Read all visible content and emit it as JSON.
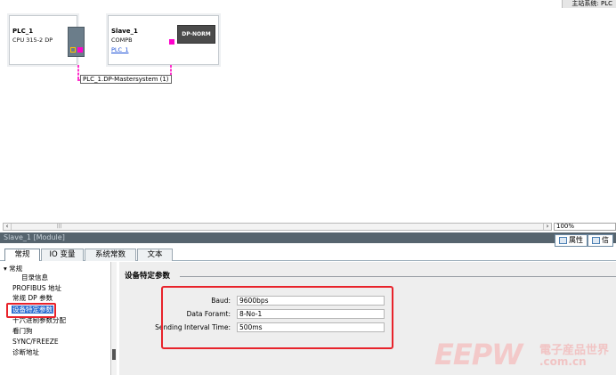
{
  "header": {
    "top_button_label": "主站系统: PLC"
  },
  "network": {
    "plc": {
      "name": "PLC_1",
      "type": "CPU 315-2 DP"
    },
    "slave": {
      "name": "Slave_1",
      "type": "COMPB",
      "link": "PLC_1",
      "module_label": "DP-NORM"
    },
    "bus_label": "PLC_1.DP-Mastersystem (1)"
  },
  "canvas": {
    "zoom": "100%"
  },
  "inspector": {
    "title": "Slave_1 [Module]",
    "tabs": [
      "属性",
      "信"
    ],
    "main_tabs": [
      "常规",
      "IO 变量",
      "系统常数",
      "文本"
    ],
    "nav": [
      "常规",
      "目录信息",
      "PROFIBUS 地址",
      "常规 DP 参数",
      "设备特定参数",
      "十六进制参数分配",
      "看门狗",
      "SYNC/FREEZE",
      "诊断地址"
    ]
  },
  "params": {
    "section_title": "设备特定参数",
    "rows": [
      {
        "label": "Baud:",
        "value": "9600bps"
      },
      {
        "label": "Data Foramt:",
        "value": "8-No-1"
      },
      {
        "label": "Sending Interval Time:",
        "value": "500ms"
      }
    ]
  },
  "watermark": {
    "logo": "EEPW",
    "cn": "電子産品世界",
    "com": ".com.cn"
  },
  "colors": {
    "bus": "#ff33cc",
    "highlight": "#e8232b",
    "header_bg": "#56646e",
    "selected": "#2d6fd1"
  }
}
